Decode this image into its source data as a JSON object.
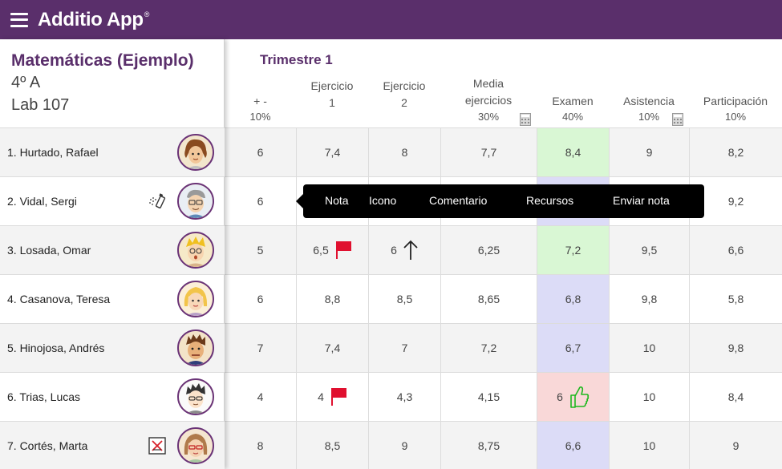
{
  "app": {
    "title": "Additio App",
    "trademark": "®",
    "menu_icon": "hamburger-menu-icon"
  },
  "class_info": {
    "name": "Matemáticas (Ejemplo)",
    "group": "4º A",
    "room": "Lab 107"
  },
  "term": "Trimestre 1",
  "columns": [
    {
      "label1": "+ -",
      "label2": "",
      "weight": "10%"
    },
    {
      "label1": "Ejercicio",
      "label2": "1",
      "weight": ""
    },
    {
      "label1": "Ejercicio",
      "label2": "2",
      "weight": ""
    },
    {
      "label1": "Media",
      "label2": "ejercicios",
      "weight": "30%"
    },
    {
      "label1": "Examen",
      "label2": "",
      "weight": "40%"
    },
    {
      "label1": "Asistencia",
      "label2": "",
      "weight": "10%"
    },
    {
      "label1": "Participación",
      "label2": "",
      "weight": "10%"
    }
  ],
  "students": [
    {
      "name": "1. Hurtado, Rafael",
      "grades": [
        "6",
        "7,4",
        "8",
        "7,7",
        "8,4",
        "9",
        "8,2"
      ]
    },
    {
      "name": "2. Vidal, Sergi",
      "grades": [
        "6",
        "",
        "",
        "",
        "",
        "",
        "9,2"
      ]
    },
    {
      "name": "3. Losada, Omar",
      "grades": [
        "5",
        "6,5",
        "6",
        "6,25",
        "7,2",
        "9,5",
        "6,6"
      ]
    },
    {
      "name": "4. Casanova, Teresa",
      "grades": [
        "6",
        "8,8",
        "8,5",
        "8,65",
        "6,8",
        "9,8",
        "5,8"
      ]
    },
    {
      "name": "5. Hinojosa, Andrés",
      "grades": [
        "7",
        "7,4",
        "7",
        "7,2",
        "6,7",
        "10",
        "9,8"
      ]
    },
    {
      "name": "6. Trias, Lucas",
      "grades": [
        "4",
        "4",
        "4,3",
        "4,15",
        "6",
        "10",
        "8,4"
      ]
    },
    {
      "name": "7. Cortés, Marta",
      "grades": [
        "8",
        "8,5",
        "9",
        "8,75",
        "6,6",
        "10",
        "9"
      ]
    }
  ],
  "popup_menu": [
    "Nota",
    "Icono",
    "Comentario",
    "Recursos",
    "Enviar nota"
  ],
  "colors": {
    "brand": "#5a2f6b",
    "green_cell": "#d9f7d4",
    "blue_cell": "#dcdcf7",
    "red_cell": "#f9d8d8",
    "flag": "#e0102f",
    "thumb": "#1fb81f"
  },
  "icons": {
    "row2_status": "spray-icon",
    "row7_status": "crossed-out-icon",
    "flag": "red-flag-icon",
    "up_arrow": "arrow-up-icon",
    "thumbs_up": "thumbs-up-icon",
    "calculator": "calculator-icon"
  }
}
